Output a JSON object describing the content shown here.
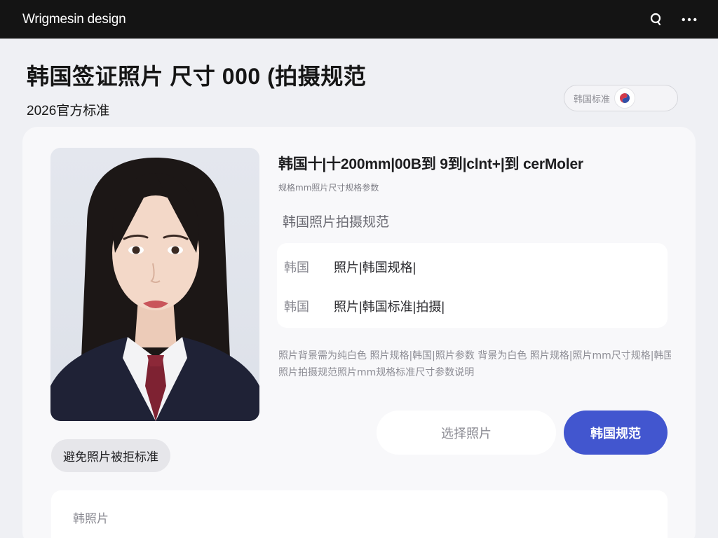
{
  "app": {
    "title": "Wrigmesin design"
  },
  "topbar": {
    "search_icon": "search-icon",
    "menu_icon": "more-horizontal-icon"
  },
  "header": {
    "title": "韩国签证照片 尺寸 000 (拍摄规范",
    "subtitle": "2026官方标准"
  },
  "lang_toggle": {
    "label": "韩国标准",
    "flag_icon": "korea-flag-icon"
  },
  "photo": {
    "alt_semantic": "sample-visa-portrait"
  },
  "spec": {
    "title": "韩国十|十200mm|00B到 9到|clnt+|到  cerMoler",
    "subtitle": "规格mm照片尺寸规格参数",
    "section_label": "韩国照片拍摄规范"
  },
  "info_rows": [
    {
      "key": "韩国",
      "value": "照片|韩国规格|"
    },
    {
      "key": "韩国",
      "value": "照片|韩国标准|拍摄|"
    }
  ],
  "description": {
    "line1": "照片背景需为纯白色 照片规格|韩国|照片参数 背景为白色 照片规格|照片mm尺寸规格|韩国规格照片要求",
    "line2": "照片拍摄规范照片mm规格标准尺寸参数说明"
  },
  "buttons": {
    "secondary": "选择照片",
    "primary": "韩国规范",
    "chip": "避免照片被拒标准"
  },
  "bottom_panel": {
    "label": "韩照片"
  },
  "colors": {
    "topbar_bg": "#141414",
    "page_bg": "#eff0f4",
    "accent": "#4256cf",
    "card_bg": "#f8f8fa"
  }
}
